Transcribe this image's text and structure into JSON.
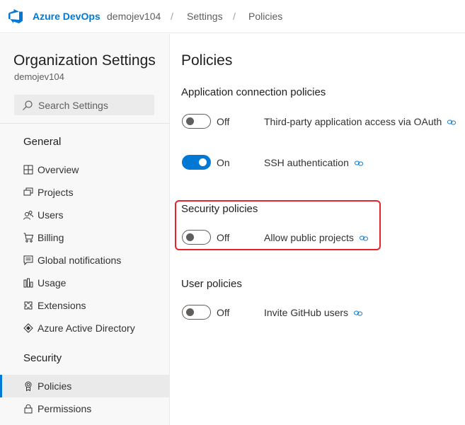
{
  "header": {
    "brand": "Azure DevOps",
    "org": "demojev104",
    "separator": "/",
    "settings": "Settings",
    "current": "Policies"
  },
  "sidebar": {
    "title": "Organization Settings",
    "org": "demojev104",
    "search_placeholder": "Search Settings",
    "general_heading": "General",
    "general_items": [
      {
        "label": "Overview",
        "icon": "overview-icon"
      },
      {
        "label": "Projects",
        "icon": "projects-icon"
      },
      {
        "label": "Users",
        "icon": "users-icon"
      },
      {
        "label": "Billing",
        "icon": "cart-icon"
      },
      {
        "label": "Global notifications",
        "icon": "notifications-icon"
      },
      {
        "label": "Usage",
        "icon": "usage-icon"
      },
      {
        "label": "Extensions",
        "icon": "extensions-icon"
      },
      {
        "label": "Azure Active Directory",
        "icon": "aad-icon"
      }
    ],
    "security_heading": "Security",
    "security_items": [
      {
        "label": "Policies",
        "icon": "policies-icon",
        "selected": true
      },
      {
        "label": "Permissions",
        "icon": "lock-icon",
        "selected": false
      }
    ]
  },
  "main": {
    "title": "Policies",
    "app_connection": {
      "heading": "Application connection policies",
      "policies": [
        {
          "state": "Off",
          "label": "Third-party application access via OAuth"
        },
        {
          "state": "On",
          "label": "SSH authentication"
        }
      ]
    },
    "security": {
      "heading": "Security policies",
      "policies": [
        {
          "state": "Off",
          "label": "Allow public projects"
        }
      ]
    },
    "user": {
      "heading": "User policies",
      "policies": [
        {
          "state": "Off",
          "label": "Invite GitHub users"
        }
      ]
    }
  },
  "colors": {
    "accent": "#0078d4",
    "highlight": "#e8212b",
    "sidebar_bg": "#f8f8f8"
  }
}
